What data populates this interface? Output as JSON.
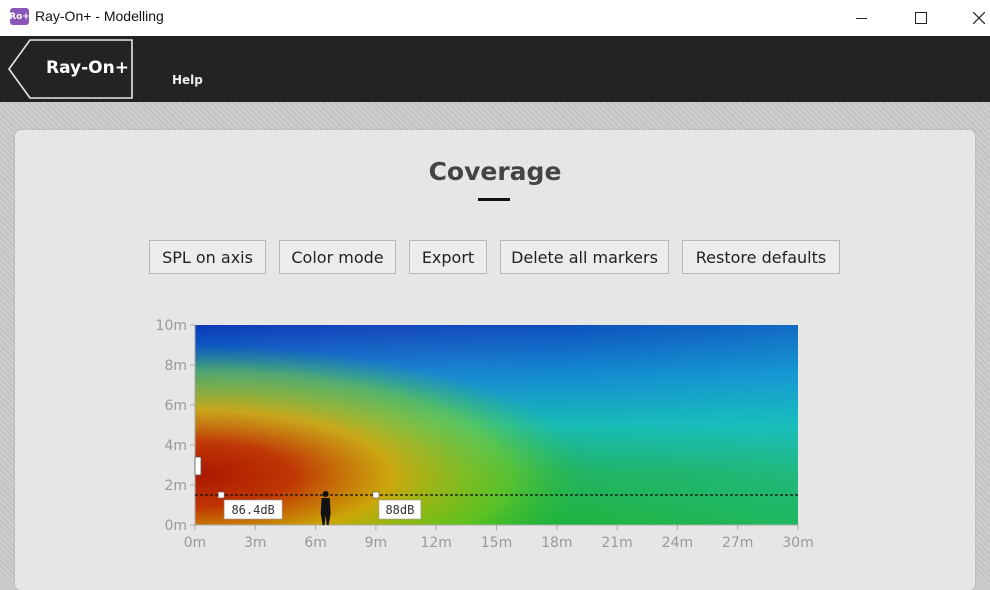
{
  "window": {
    "title": "Ray-On+ - Modelling",
    "icon_text": "Ro+"
  },
  "toolbar": {
    "back_label": "Ray-On+",
    "help_label": "Help"
  },
  "page": {
    "title": "Coverage"
  },
  "buttons": [
    {
      "label": "SPL on axis"
    },
    {
      "label": "Color mode"
    },
    {
      "label": "Export"
    },
    {
      "label": "Delete all markers"
    },
    {
      "label": "Restore defaults"
    }
  ],
  "chart_data": {
    "type": "heatmap",
    "title": "",
    "xlabel": "",
    "ylabel": "",
    "x_ticks": [
      "0m",
      "3m",
      "6m",
      "9m",
      "12m",
      "15m",
      "18m",
      "21m",
      "24m",
      "27m",
      "30m"
    ],
    "y_ticks": [
      "0m",
      "2m",
      "4m",
      "6m",
      "8m",
      "10m"
    ],
    "xlim": [
      0,
      30
    ],
    "ylim": [
      0,
      10
    ],
    "listening_height": 1.5,
    "markers": [
      {
        "x": 1.3,
        "label": "86.4dB"
      },
      {
        "x": 9.0,
        "label": "88dB"
      }
    ],
    "person_x": 6.5,
    "colors": {
      "hot": "#b32000",
      "warm": "#e8d000",
      "mid": "#1fb34a",
      "cool": "#1ec8d8",
      "cold": "#0a3fb8"
    }
  }
}
